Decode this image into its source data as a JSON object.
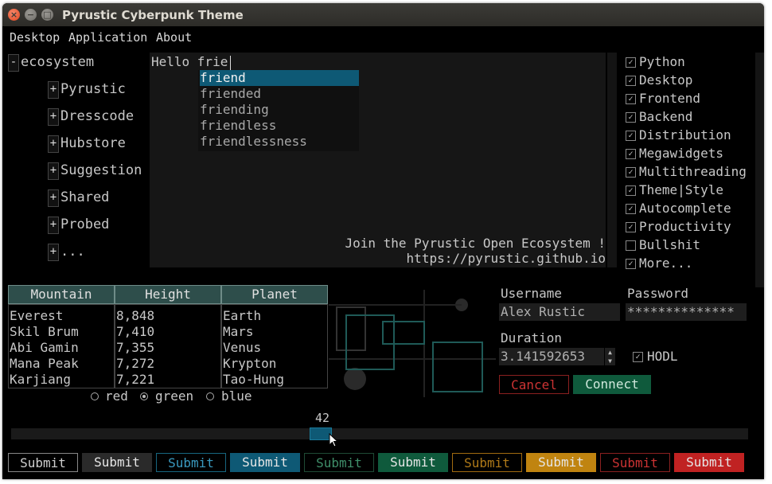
{
  "window": {
    "title": "Pyrustic Cyberpunk Theme",
    "close_glyph": "×",
    "min_glyph": "−",
    "max_glyph": "□"
  },
  "menu": [
    "Desktop",
    "Application",
    "About"
  ],
  "tree": {
    "root": {
      "toggle": "-",
      "label": "ecosystem"
    },
    "children": [
      {
        "toggle": "+",
        "label": "Pyrustic"
      },
      {
        "toggle": "+",
        "label": "Dresscode"
      },
      {
        "toggle": "+",
        "label": "Hubstore"
      },
      {
        "toggle": "+",
        "label": "Suggestion"
      },
      {
        "toggle": "+",
        "label": "Shared"
      },
      {
        "toggle": "+",
        "label": "Probed"
      },
      {
        "toggle": "+",
        "label": "..."
      }
    ]
  },
  "editor": {
    "text": "Hello frie",
    "footer_line1": "Join the Pyrustic Open Ecosystem !",
    "footer_line2": "https://pyrustic.github.io",
    "suggestions": [
      "friend",
      "friended",
      "friending",
      "friendless",
      "friendlessness"
    ],
    "selected_suggestion": 0
  },
  "checklist": [
    {
      "label": "Python",
      "checked": true
    },
    {
      "label": "Desktop",
      "checked": true
    },
    {
      "label": "Frontend",
      "checked": true
    },
    {
      "label": "Backend",
      "checked": true
    },
    {
      "label": "Distribution",
      "checked": true
    },
    {
      "label": "Megawidgets",
      "checked": true
    },
    {
      "label": "Multithreading",
      "checked": true
    },
    {
      "label": "Theme|Style",
      "checked": true
    },
    {
      "label": "Autocomplete",
      "checked": true
    },
    {
      "label": "Productivity",
      "checked": true
    },
    {
      "label": "Bullshit",
      "checked": false
    },
    {
      "label": "More...",
      "checked": true
    }
  ],
  "check_glyph": "✓",
  "table": {
    "headers": [
      "Mountain",
      "Height",
      "Planet"
    ],
    "rows": [
      [
        "Everest",
        "8,848",
        "Earth"
      ],
      [
        "Skil Brum",
        "7,410",
        "Mars"
      ],
      [
        "Abi Gamin",
        "7,355",
        "Venus"
      ],
      [
        "Mana Peak",
        "7,272",
        "Krypton"
      ],
      [
        "Karjiang",
        "7,221",
        "Tao-Hung"
      ]
    ]
  },
  "radios": [
    {
      "label": "red",
      "selected": false
    },
    {
      "label": "green",
      "selected": true
    },
    {
      "label": "blue",
      "selected": false
    }
  ],
  "form": {
    "username_label": "Username",
    "username_value": "Alex Rustic",
    "password_label": "Password",
    "password_value": "**************",
    "duration_label": "Duration",
    "duration_value": "3.141592653",
    "spin_up": "▲",
    "spin_down": "▼",
    "hodl_label": "HODL",
    "hodl_checked": true,
    "cancel_label": "Cancel",
    "connect_label": "Connect"
  },
  "slider": {
    "value_label": "42",
    "value": 42,
    "min": 0,
    "max": 100
  },
  "bottom_buttons": [
    {
      "label": "Submit",
      "style": "outline",
      "color": "#888888"
    },
    {
      "label": "Submit",
      "style": "filled",
      "color": "#2a2a2a"
    },
    {
      "label": "Submit",
      "style": "outline",
      "color": "#17667f"
    },
    {
      "label": "Submit",
      "style": "filled",
      "color": "#0e5975"
    },
    {
      "label": "Submit",
      "style": "outline",
      "color": "#1e4a35"
    },
    {
      "label": "Submit",
      "style": "filled",
      "color": "#0f5a3c"
    },
    {
      "label": "Submit",
      "style": "outline",
      "color": "#a06a10"
    },
    {
      "label": "Submit",
      "style": "filled",
      "color": "#c08410"
    },
    {
      "label": "Submit",
      "style": "outline",
      "color": "#8a2020"
    },
    {
      "label": "Submit",
      "style": "filled",
      "color": "#c02222"
    }
  ],
  "colors": {
    "accent_blue": "#0e5975",
    "accent_green": "#0f5a3c",
    "accent_red": "#c02222",
    "accent_gold": "#c08410",
    "table_header": "#2e4e4b"
  }
}
